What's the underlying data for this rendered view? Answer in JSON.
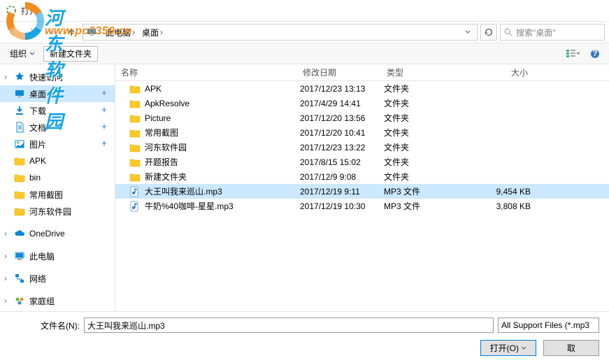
{
  "window": {
    "title": "打开"
  },
  "watermark": {
    "title": "河东软件园",
    "url": "www.pc0359.cn"
  },
  "navbar": {
    "crumbs": [
      "此电脑",
      "桌面"
    ],
    "search_placeholder": "搜索\"桌面\""
  },
  "toolbar": {
    "organize": "组织",
    "newfolder": "新建文件夹"
  },
  "sidebar": {
    "items": [
      {
        "label": "快速访问",
        "icon": "star"
      },
      {
        "label": "桌面",
        "icon": "desktop",
        "pinned": true,
        "selected": true
      },
      {
        "label": "下载",
        "icon": "download",
        "pinned": true
      },
      {
        "label": "文档",
        "icon": "document",
        "pinned": true
      },
      {
        "label": "图片",
        "icon": "picture",
        "pinned": true
      },
      {
        "label": "APK",
        "icon": "folder"
      },
      {
        "label": "bin",
        "icon": "folder"
      },
      {
        "label": "常用截图",
        "icon": "folder"
      },
      {
        "label": "河东软件园",
        "icon": "folder"
      },
      {
        "label": "OneDrive",
        "icon": "onedrive"
      },
      {
        "label": "此电脑",
        "icon": "pc"
      },
      {
        "label": "网络",
        "icon": "network"
      },
      {
        "label": "家庭组",
        "icon": "home"
      }
    ]
  },
  "filelist": {
    "headers": {
      "name": "名称",
      "date": "修改日期",
      "type": "类型",
      "size": "大小"
    },
    "rows": [
      {
        "name": "APK",
        "date": "2017/12/23 13:13",
        "type": "文件夹",
        "size": "",
        "icon": "folder"
      },
      {
        "name": "ApkResolve",
        "date": "2017/4/29 14:41",
        "type": "文件夹",
        "size": "",
        "icon": "folder"
      },
      {
        "name": "Picture",
        "date": "2017/12/20 13:56",
        "type": "文件夹",
        "size": "",
        "icon": "folder"
      },
      {
        "name": "常用截图",
        "date": "2017/12/20 10:41",
        "type": "文件夹",
        "size": "",
        "icon": "folder"
      },
      {
        "name": "河东软件园",
        "date": "2017/12/23 13:22",
        "type": "文件夹",
        "size": "",
        "icon": "folder"
      },
      {
        "name": "开题报告",
        "date": "2017/8/15 15:02",
        "type": "文件夹",
        "size": "",
        "icon": "folder"
      },
      {
        "name": "新建文件夹",
        "date": "2017/12/9 9:08",
        "type": "文件夹",
        "size": "",
        "icon": "folder"
      },
      {
        "name": "大王叫我来巡山.mp3",
        "date": "2017/12/19 9:11",
        "type": "MP3 文件",
        "size": "9,454 KB",
        "icon": "mp3",
        "selected": true
      },
      {
        "name": "牛奶%40咖啡-星星.mp3",
        "date": "2017/12/19 10:30",
        "type": "MP3 文件",
        "size": "3,808 KB",
        "icon": "mp3"
      }
    ]
  },
  "footer": {
    "filename_label": "文件名(N):",
    "filename_value": "大王叫我来巡山.mp3",
    "filter": "All Support Files (*.mp3",
    "open": "打开(O)",
    "cancel": "取"
  }
}
